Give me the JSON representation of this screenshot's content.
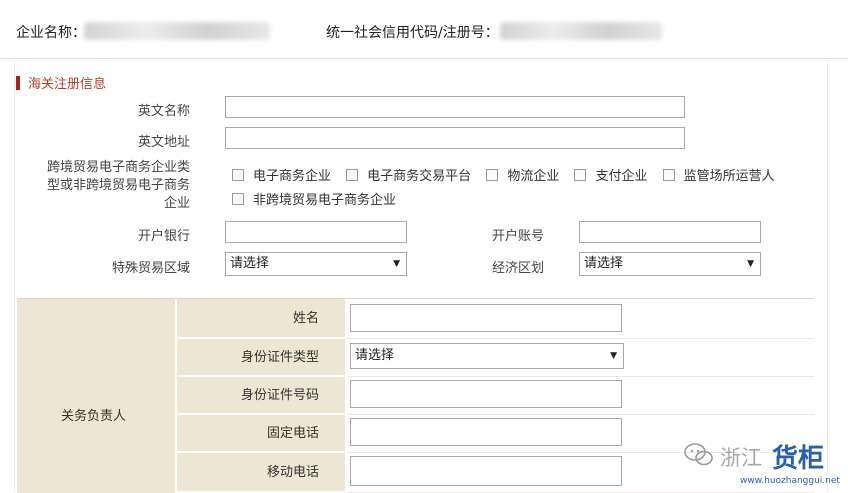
{
  "header": {
    "company_name_label": "企业名称：",
    "credit_code_label": "统一社会信用代码/注册号："
  },
  "section": {
    "title": "海关注册信息"
  },
  "form": {
    "english_name_label": "英文名称",
    "english_address_label": "英文地址",
    "enterprise_type_label_1": "跨境贸易电子商务企业类",
    "enterprise_type_label_2": "型或非跨境贸易电子商务",
    "enterprise_type_label_3": "企业",
    "options": [
      "电子商务企业",
      "电子商务交易平台",
      "物流企业",
      "支付企业",
      "监管场所运营人",
      "非跨境贸易电子商务企业"
    ],
    "bank_label": "开户银行",
    "account_label": "开户账号",
    "special_zone_label": "特殊贸易区域",
    "special_zone_value": "请选择",
    "economic_zone_label": "经济区划",
    "economic_zone_value": "请选择"
  },
  "customs_contact": {
    "group_label": "关务负责人",
    "name_label": "姓名",
    "id_type_label": "身份证件类型",
    "id_type_value": "请选择",
    "id_number_label": "身份证件号码",
    "phone_label": "固定电话",
    "mobile_label": "移动电话"
  },
  "watermark": {
    "text": "浙江",
    "brand": "货柜",
    "url": "www.huozhanggui.net"
  },
  "icons": {
    "dropdown": "triangle-down-icon",
    "checkbox": "checkbox-unchecked-icon"
  },
  "colors": {
    "accent": "#a0271b",
    "section_text": "#b3412e",
    "table_label_bg": "#ece6d3",
    "watermark_brand": "#2b5fa8"
  }
}
